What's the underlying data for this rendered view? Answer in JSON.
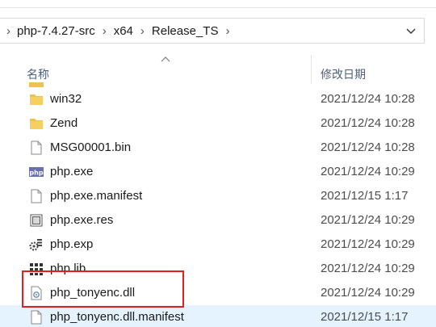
{
  "breadcrumb": {
    "items": [
      "php-7.4.27-src",
      "x64",
      "Release_TS"
    ],
    "separator": "›"
  },
  "columns": {
    "name": "名称",
    "date": "修改日期"
  },
  "files": [
    {
      "name": "win32",
      "date": "2021/12/24 10:28",
      "icon": "folder-icon"
    },
    {
      "name": "Zend",
      "date": "2021/12/24 10:28",
      "icon": "folder-icon"
    },
    {
      "name": "MSG00001.bin",
      "date": "2021/12/24 10:28",
      "icon": "file-icon"
    },
    {
      "name": "php.exe",
      "date": "2021/12/24 10:29",
      "icon": "php-exe-icon"
    },
    {
      "name": "php.exe.manifest",
      "date": "2021/12/15 1:17",
      "icon": "file-icon"
    },
    {
      "name": "php.exe.res",
      "date": "2021/12/24 10:29",
      "icon": "resource-icon"
    },
    {
      "name": "php.exp",
      "date": "2021/12/24 10:29",
      "icon": "exp-icon"
    },
    {
      "name": "php.lib",
      "date": "2021/12/24 10:29",
      "icon": "lib-icon"
    },
    {
      "name": "php_tonyenc.dll",
      "date": "2021/12/24 10:29",
      "icon": "dll-icon"
    },
    {
      "name": "php_tonyenc.dll.manifest",
      "date": "2021/12/15 1:17",
      "icon": "file-icon"
    }
  ],
  "selected_row": 9,
  "colors": {
    "highlight": "#e02020",
    "folder": "#f0c24b",
    "selection": "#e5f3ff",
    "header_text": "#4c607a"
  }
}
